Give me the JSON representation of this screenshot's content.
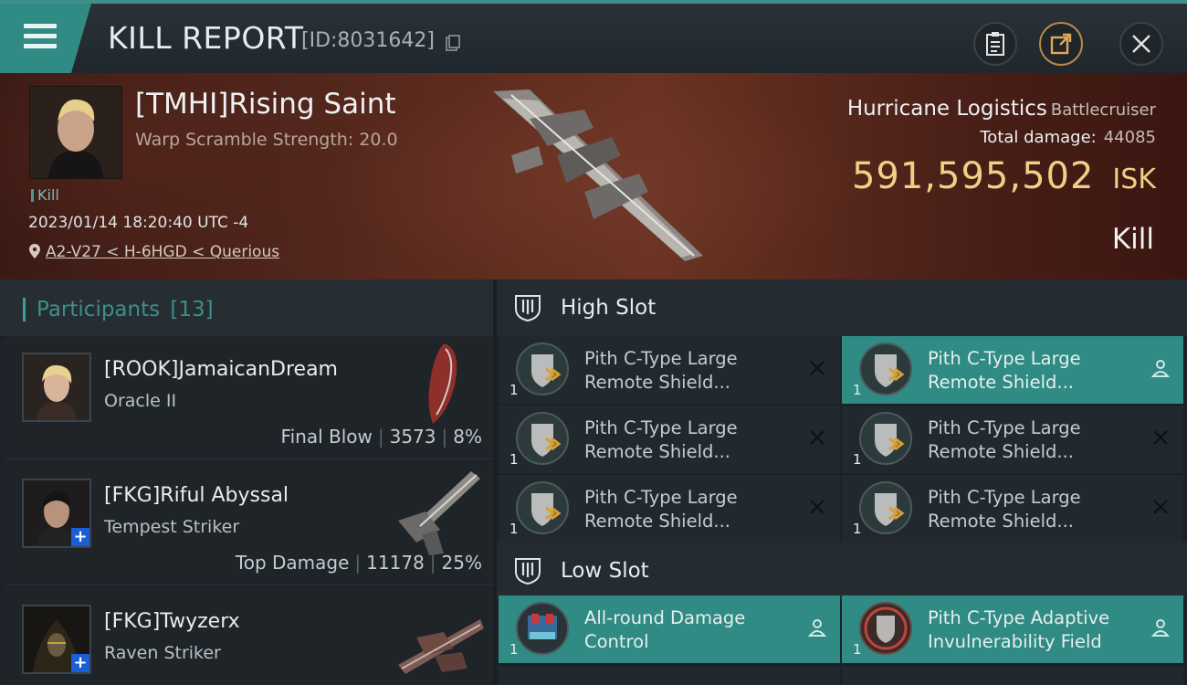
{
  "header": {
    "title": "KILL REPORT",
    "id_label": "[ID:8031642]"
  },
  "victim": {
    "name": "[TMHI]Rising Saint",
    "warp_scramble": "Warp Scramble Strength: 20.0",
    "tag": "Kill",
    "timestamp": "2023/01/14 18:20:40 UTC -4",
    "location": "A2-V27 < H-6HGD < Querious",
    "ship_name": "Hurricane Logistics",
    "ship_class": "Battlecruiser",
    "total_damage_label": "Total damage:",
    "total_damage": "44085",
    "isk_value": "591,595,502",
    "isk_unit": "ISK",
    "result": "Kill"
  },
  "participants": {
    "title": "Participants",
    "count": "[13]",
    "items": [
      {
        "name": "[ROOK]JamaicanDream",
        "ship": "Oracle II",
        "stat_label": "Final Blow",
        "damage": "3573",
        "percent": "8%",
        "has_plus": false
      },
      {
        "name": "[FKG]Riful Abyssal",
        "ship": "Tempest Striker",
        "stat_label": "Top Damage",
        "damage": "11178",
        "percent": "25%",
        "has_plus": true
      },
      {
        "name": "[FKG]Twyzerx",
        "ship": "Raven Striker",
        "stat_label": "",
        "damage": "",
        "percent": "",
        "has_plus": true
      }
    ]
  },
  "fitting": {
    "high_slot": {
      "title": "High Slot",
      "modules": [
        {
          "name": "Pith C-Type Large Remote Shield...",
          "qty": "1",
          "action": "x-icon",
          "selected": false
        },
        {
          "name": "Pith C-Type Large Remote Shield...",
          "qty": "1",
          "action": "person-icon",
          "selected": true
        },
        {
          "name": "Pith C-Type Large Remote Shield...",
          "qty": "1",
          "action": "x-icon",
          "selected": false
        },
        {
          "name": "Pith C-Type Large Remote Shield...",
          "qty": "1",
          "action": "x-icon",
          "selected": false
        },
        {
          "name": "Pith C-Type Large Remote Shield...",
          "qty": "1",
          "action": "x-icon",
          "selected": false
        },
        {
          "name": "Pith C-Type Large Remote Shield...",
          "qty": "1",
          "action": "x-icon",
          "selected": false
        }
      ]
    },
    "low_slot": {
      "title": "Low Slot",
      "modules": [
        {
          "name": "All-round Damage Control",
          "qty": "1",
          "action": "person-icon",
          "selected": true
        },
        {
          "name": "Pith C-Type Adaptive Invulnerability Field",
          "qty": "1",
          "action": "person-icon",
          "selected": true
        }
      ]
    }
  },
  "colors": {
    "accent": "#2f8b84",
    "isk": "#f1cf85",
    "banner": "#5a2a1e"
  }
}
